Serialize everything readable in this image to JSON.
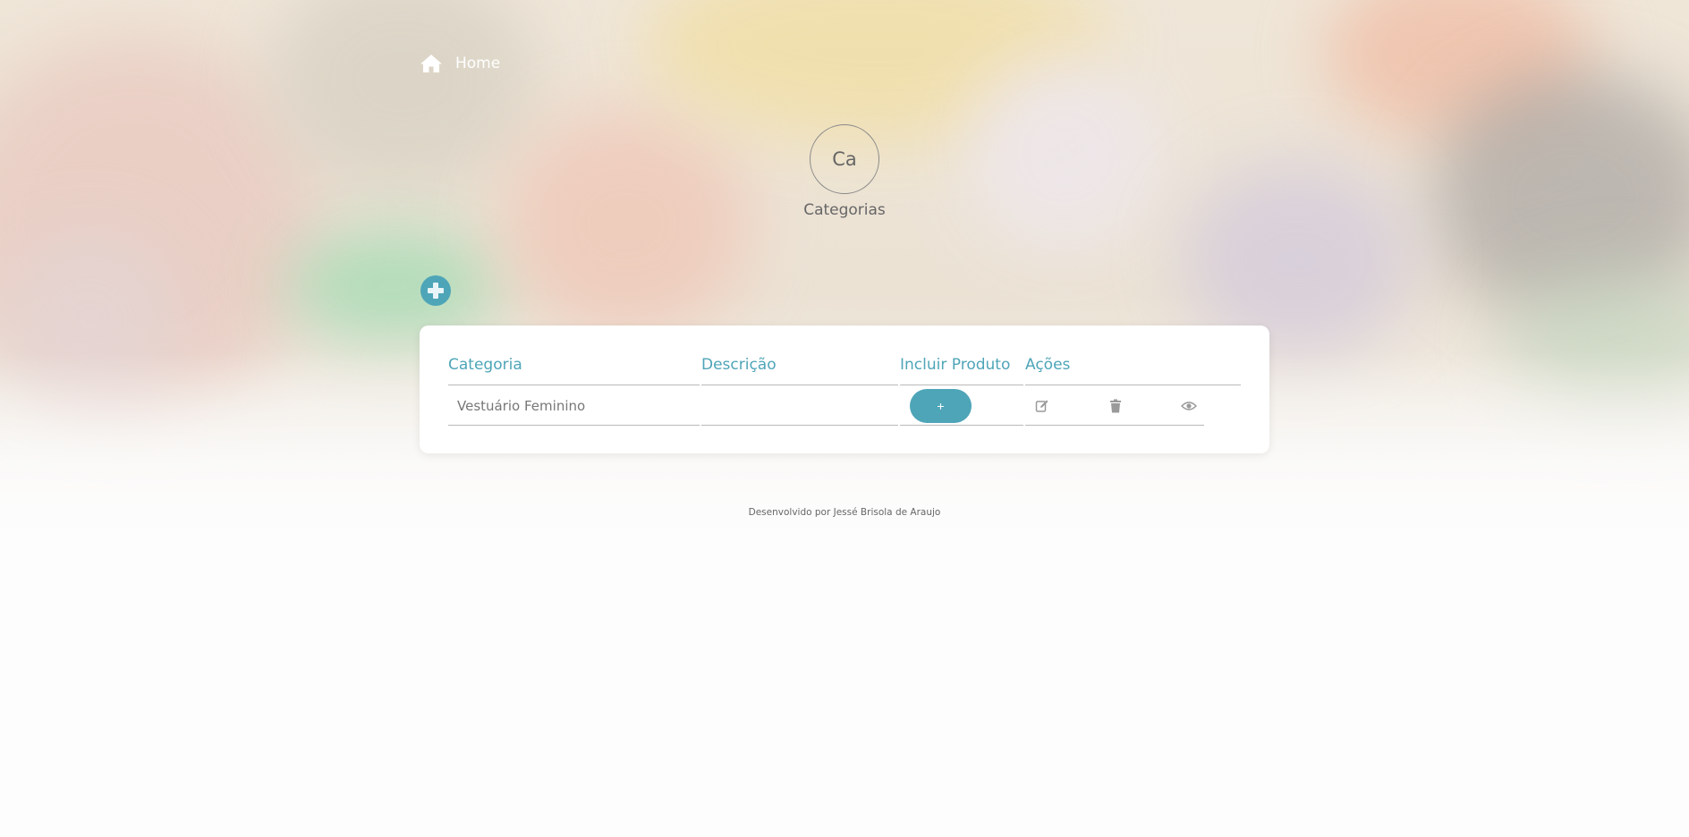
{
  "nav": {
    "home_label": "Home"
  },
  "header": {
    "avatar_initials": "Ca",
    "title": "Categorias"
  },
  "table": {
    "columns": [
      "Categoria",
      "Descrição",
      "Incluir Produto",
      "Ações"
    ],
    "rows": [
      {
        "categoria": "Vestuário Feminino",
        "descricao": "",
        "include_label": "+"
      }
    ]
  },
  "footer": {
    "text": "Desenvolvido por Jessé Brisola de Araujo"
  },
  "icons": {
    "home": "home-icon",
    "add": "plus-circle-icon",
    "edit": "edit-icon",
    "delete": "trash-icon",
    "view": "eye-icon"
  },
  "colors": {
    "accent": "#4ea5b8",
    "text": "#666666",
    "background": "#fdfdfd",
    "card": "#ffffff"
  }
}
